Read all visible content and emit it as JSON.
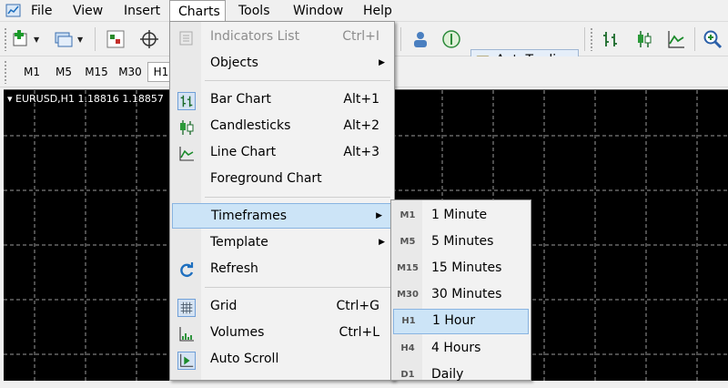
{
  "menubar": {
    "items": [
      {
        "label": "File"
      },
      {
        "label": "View"
      },
      {
        "label": "Insert"
      },
      {
        "label": "Charts"
      },
      {
        "label": "Tools"
      },
      {
        "label": "Window"
      },
      {
        "label": "Help"
      }
    ]
  },
  "toolbar": {
    "autotrading_label": "AutoTrading",
    "timeframes": [
      "M1",
      "M5",
      "M15",
      "M30",
      "H1"
    ]
  },
  "chart": {
    "title": "EURUSD,H1  1.18816 1.18857"
  },
  "charts_menu": {
    "indicators_list": {
      "label": "Indicators List",
      "shortcut": "Ctrl+I"
    },
    "objects": {
      "label": "Objects"
    },
    "bar_chart": {
      "label": "Bar Chart",
      "shortcut": "Alt+1"
    },
    "candlesticks": {
      "label": "Candlesticks",
      "shortcut": "Alt+2"
    },
    "line_chart": {
      "label": "Line Chart",
      "shortcut": "Alt+3"
    },
    "foreground_chart": {
      "label": "Foreground Chart"
    },
    "timeframes": {
      "label": "Timeframes"
    },
    "template": {
      "label": "Template"
    },
    "refresh": {
      "label": "Refresh"
    },
    "grid": {
      "label": "Grid",
      "shortcut": "Ctrl+G"
    },
    "volumes": {
      "label": "Volumes",
      "shortcut": "Ctrl+L"
    },
    "auto_scroll": {
      "label": "Auto Scroll"
    }
  },
  "timeframes_menu": {
    "items": [
      {
        "code": "M1",
        "label": "1 Minute"
      },
      {
        "code": "M5",
        "label": "5 Minutes"
      },
      {
        "code": "M15",
        "label": "15 Minutes"
      },
      {
        "code": "M30",
        "label": "30 Minutes"
      },
      {
        "code": "H1",
        "label": "1 Hour"
      },
      {
        "code": "H4",
        "label": "4 Hours"
      },
      {
        "code": "D1",
        "label": "Daily"
      }
    ]
  },
  "colors": {
    "chart_background": "#000000",
    "grid": "#b0b0b0",
    "highlight": "#cce4f7",
    "accent_icon": "#1e6fbf"
  }
}
